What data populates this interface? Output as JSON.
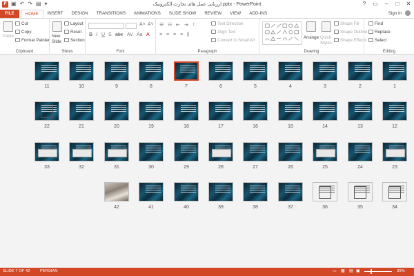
{
  "titlebar": {
    "title": "ارزیابی عمل های تجارت الکترونیک.pptx - PowerPoint",
    "app_icon": "P",
    "qat": [
      "save-icon",
      "undo-icon",
      "redo-icon",
      "present-icon",
      "customize-icon"
    ],
    "qat_glyphs": [
      "▣",
      "↶",
      "↷",
      "▤",
      "▾"
    ],
    "controls": [
      "?",
      "▭",
      "–",
      "□",
      "✕"
    ]
  },
  "tabs": [
    "FILE",
    "HOME",
    "INSERT",
    "DESIGN",
    "TRANSITIONS",
    "ANIMATIONS",
    "SLIDE SHOW",
    "REVIEW",
    "VIEW",
    "ADD-INS"
  ],
  "active_tab": "HOME",
  "signin": "Sign in",
  "ribbon": {
    "clipboard": {
      "label": "Clipboard",
      "paste": "Paste",
      "cut": "Cut",
      "copy": "Copy",
      "format_painter": "Format Painter"
    },
    "slides": {
      "label": "Slides",
      "new_slide": "New",
      "new_slide2": "Slide",
      "layout": "Layout",
      "reset": "Reset",
      "section": "Section"
    },
    "font": {
      "label": "Font"
    },
    "paragraph": {
      "label": "Paragraph",
      "text_direction": "Text Direction",
      "align_text": "Align Text",
      "convert_smartart": "Convert to SmartArt"
    },
    "drawing": {
      "label": "Drawing",
      "arrange": "Arrange",
      "quick_styles": "Quick",
      "quick_styles2": "Styles",
      "shape_fill": "Shape Fill",
      "shape_outline": "Shape Outline",
      "shape_effects": "Shape Effects"
    },
    "editing": {
      "label": "Editing",
      "find": "Find",
      "replace": "Replace",
      "select": "Select"
    }
  },
  "slides": [
    {
      "n": "1",
      "kind": "dark"
    },
    {
      "n": "2",
      "kind": "dark"
    },
    {
      "n": "3",
      "kind": "dark"
    },
    {
      "n": "4",
      "kind": "dark"
    },
    {
      "n": "5",
      "kind": "dark"
    },
    {
      "n": "6",
      "kind": "dark"
    },
    {
      "n": "7",
      "kind": "dark",
      "selected": true
    },
    {
      "n": "8",
      "kind": "dark"
    },
    {
      "n": "9",
      "kind": "dark"
    },
    {
      "n": "10",
      "kind": "dark"
    },
    {
      "n": "11",
      "kind": "dark"
    },
    {
      "n": "12",
      "kind": "dark"
    },
    {
      "n": "13",
      "kind": "dark"
    },
    {
      "n": "14",
      "kind": "dark"
    },
    {
      "n": "15",
      "kind": "dark"
    },
    {
      "n": "16",
      "kind": "dark"
    },
    {
      "n": "17",
      "kind": "dark"
    },
    {
      "n": "18",
      "kind": "dark"
    },
    {
      "n": "19",
      "kind": "dark"
    },
    {
      "n": "20",
      "kind": "dark"
    },
    {
      "n": "21",
      "kind": "dark"
    },
    {
      "n": "22",
      "kind": "diagram"
    },
    {
      "n": "23",
      "kind": "table"
    },
    {
      "n": "24",
      "kind": "dark"
    },
    {
      "n": "25",
      "kind": "table"
    },
    {
      "n": "26",
      "kind": "dark"
    },
    {
      "n": "27",
      "kind": "dark"
    },
    {
      "n": "28",
      "kind": "table"
    },
    {
      "n": "29",
      "kind": "dark"
    },
    {
      "n": "30",
      "kind": "dark"
    },
    {
      "n": "31",
      "kind": "table"
    },
    {
      "n": "32",
      "kind": "table"
    },
    {
      "n": "33",
      "kind": "table"
    },
    {
      "n": "34",
      "kind": "light"
    },
    {
      "n": "35",
      "kind": "light"
    },
    {
      "n": "36",
      "kind": "light"
    },
    {
      "n": "37",
      "kind": "dark"
    },
    {
      "n": "38",
      "kind": "dark"
    },
    {
      "n": "39",
      "kind": "dark"
    },
    {
      "n": "40",
      "kind": "dark"
    },
    {
      "n": "41",
      "kind": "dark"
    },
    {
      "n": "42",
      "kind": "photo"
    }
  ],
  "status": {
    "slide_info": "SLIDE 7 OF 42",
    "language": "PERSIAN",
    "zoom": "30%",
    "zoom_fraction": 0.3
  }
}
